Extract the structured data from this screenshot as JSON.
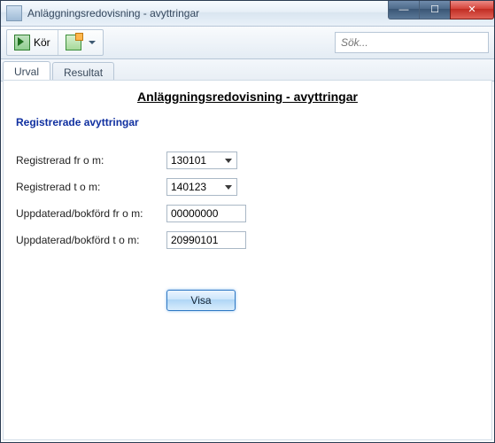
{
  "window": {
    "title": "Anläggningsredovisning - avyttringar"
  },
  "toolbar": {
    "run_label": "Kör",
    "search_placeholder": "Sök..."
  },
  "tabs": {
    "urval": "Urval",
    "resultat": "Resultat"
  },
  "page": {
    "title": "Anläggningsredovisning - avyttringar",
    "section": "Registrerade avyttringar"
  },
  "form": {
    "reg_from_label": "Registrerad fr o m:",
    "reg_from_value": "130101",
    "reg_to_label": "Registrerad t o m:",
    "reg_to_value": "140123",
    "upd_from_label": "Uppdaterad/bokförd fr o m:",
    "upd_from_value": "00000000",
    "upd_to_label": "Uppdaterad/bokförd t o m:",
    "upd_to_value": "20990101"
  },
  "action": {
    "visa": "Visa"
  }
}
